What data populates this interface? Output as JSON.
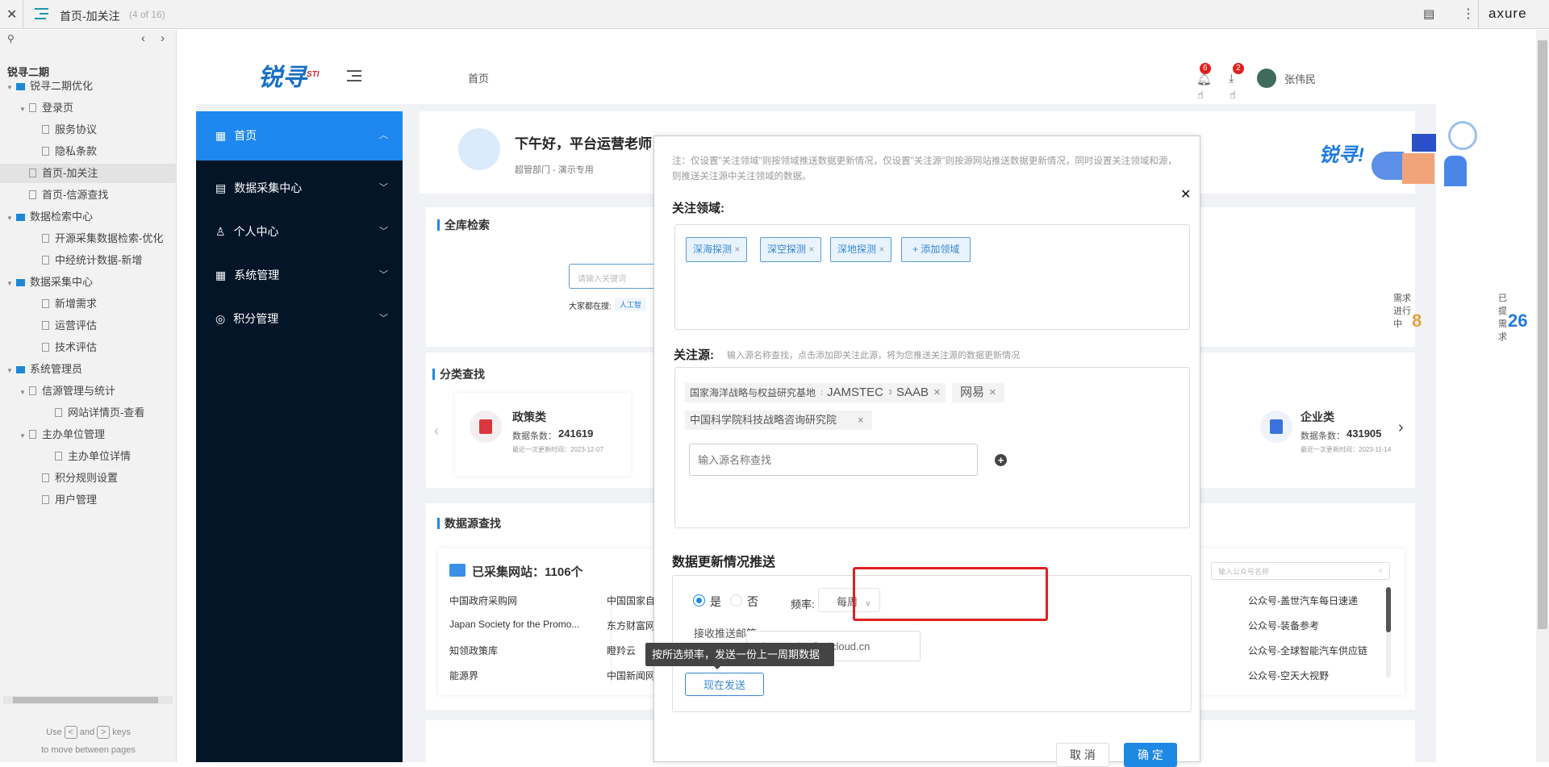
{
  "viewer": {
    "title": "首页-加关注",
    "page_count": "(4 of 16)",
    "brand": "axure",
    "project": "锐寻二期",
    "hint_use": "Use",
    "hint_and": "and",
    "hint_keys": "keys",
    "hint_line2": "to move between pages",
    "tree": [
      {
        "label": "锐寻二期优化",
        "type": "folder",
        "depth": 0,
        "expanded": true
      },
      {
        "label": "登录页",
        "type": "page",
        "depth": 1,
        "expanded": true
      },
      {
        "label": "服务协议",
        "type": "page",
        "depth": 2
      },
      {
        "label": "隐私条款",
        "type": "page",
        "depth": 2
      },
      {
        "label": "首页-加关注",
        "type": "page",
        "depth": 1,
        "selected": true
      },
      {
        "label": "首页-信源查找",
        "type": "page",
        "depth": 1
      },
      {
        "label": "数据检索中心",
        "type": "folder",
        "depth": 0,
        "expanded": true
      },
      {
        "label": "开源采集数据检索-优化",
        "type": "page",
        "depth": 2
      },
      {
        "label": "中经统计数据-新增",
        "type": "page",
        "depth": 2
      },
      {
        "label": "数据采集中心",
        "type": "folder",
        "depth": 0,
        "expanded": true
      },
      {
        "label": "新增需求",
        "type": "page",
        "depth": 2
      },
      {
        "label": "运营评估",
        "type": "page",
        "depth": 2
      },
      {
        "label": "技术评估",
        "type": "page",
        "depth": 2
      },
      {
        "label": "系统管理员",
        "type": "folder",
        "depth": 0,
        "expanded": true
      },
      {
        "label": "信源管理与统计",
        "type": "page",
        "depth": 1,
        "expanded": true
      },
      {
        "label": "网站详情页-查看",
        "type": "page",
        "depth": 3
      },
      {
        "label": "主办单位管理",
        "type": "page",
        "depth": 1,
        "expanded": true
      },
      {
        "label": "主办单位详情",
        "type": "page",
        "depth": 3
      },
      {
        "label": "积分规则设置",
        "type": "page",
        "depth": 2
      },
      {
        "label": "用户管理",
        "type": "page",
        "depth": 2
      }
    ]
  },
  "app": {
    "logo_text": "锐寻",
    "logo_sup": "STI",
    "breadcrumb": "首页",
    "notif_count": "6",
    "download_count": "2",
    "user_name": "张伟民",
    "nav": [
      {
        "label": "首页",
        "active": true
      },
      {
        "label": "数据采集中心"
      },
      {
        "label": "个人中心"
      },
      {
        "label": "系统管理"
      },
      {
        "label": "积分管理"
      }
    ],
    "greeting": "下午好，平台运营老师",
    "dept": "超管部门 - 演示专用",
    "welcome_tail": "锐寻!",
    "search_title": "全库检索",
    "search_placeholder": "请输入关键词",
    "hot_label": "大家都在搜:",
    "hot_tag": "人工智",
    "stats": [
      {
        "label": "需求进行中",
        "value": "8",
        "color": "#e6a23c"
      },
      {
        "label": "已提需求",
        "value": "26",
        "color": "#1e7be0"
      }
    ],
    "category_title": "分类查找",
    "categories": [
      {
        "name": "政策类",
        "count_label": "数据条数：",
        "count": "241619",
        "updated": "最近一次更新时间：2023-12-07"
      },
      {
        "name": "企业类",
        "count_label": "数据条数：",
        "count": "431905",
        "updated": "最近一次更新时间：2023-11-14"
      }
    ],
    "source_title": "数据源查找",
    "sites_label": "已采集网站：1106个",
    "sites_col1": [
      "中国政府采购网",
      "Japan Society for the Promo...",
      "知领政策库",
      "能源界"
    ],
    "sites_col2": [
      "中国国家自",
      "东方财富网",
      "瞪羚云",
      "中国新闻网"
    ],
    "wechat_placeholder": "输入公众号名称",
    "wechat_list": [
      "公众号-盖世汽车每日速递",
      "公众号-装备参考",
      "公众号-全球智能汽车供应链",
      "公众号-空天大视野"
    ]
  },
  "modal": {
    "note": "注：仅设置\"关注领域\"则按领域推送数据更新情况，仅设置\"关注源\"则按源网站推送数据更新情况，同时设置关注领域和源，则推送关注源中关注领域的数据。",
    "fields_label": "关注领域:",
    "fields": [
      "深海探测",
      "深空探测",
      "深地探测"
    ],
    "add_field": "+ 添加领域",
    "sources_label": "关注源:",
    "sources_hint": "输入源名称查找，点击添加即关注此源，将为您推送关注源的数据更新情况",
    "sources": [
      "国家海洋战略与权益研究基地",
      "JAMSTEC",
      "SAAB",
      "网易",
      "中国科学院科技战略咨询研究院"
    ],
    "source_placeholder": "输入源名称查找",
    "push_title": "数据更新情况推送",
    "yes": "是",
    "no": "否",
    "push_enabled": true,
    "freq_label": "频率:",
    "freq_value": "每周",
    "email_label": "接收推送邮箱",
    "email_value": "zhangweim@sticloud.cn",
    "tooltip": "按所选频率，发送一份上一周期数据",
    "send_now": "现在发送",
    "cancel": "取 消",
    "confirm": "确 定",
    "highlight_color": "#e02020",
    "accent": "#1e88e5"
  }
}
